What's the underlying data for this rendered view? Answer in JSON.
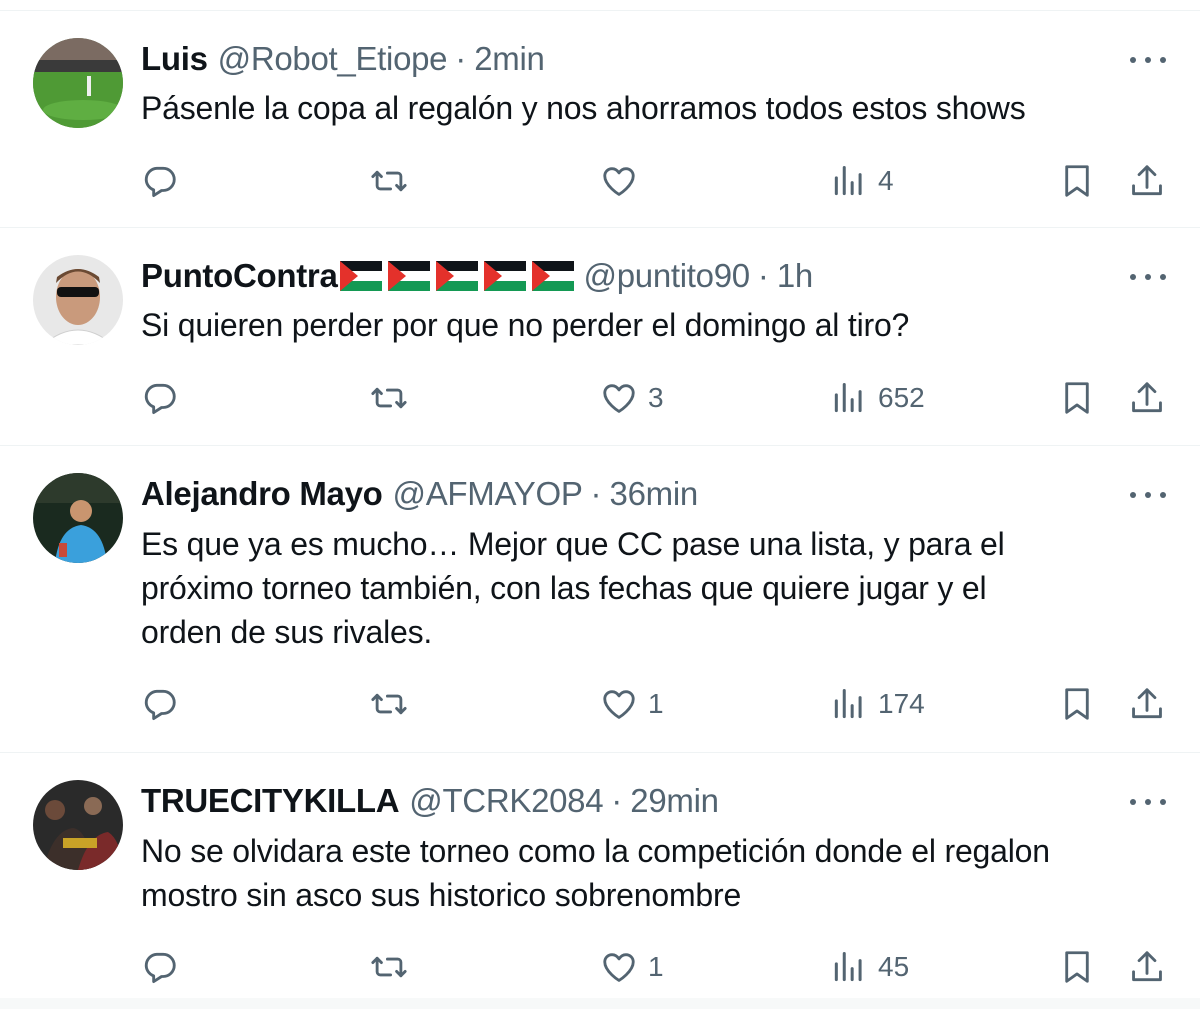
{
  "colors": {
    "text": "#0f1419",
    "muted": "#536471",
    "divider": "#eff3f4",
    "flag_red": "#e4312b",
    "flag_green": "#149954"
  },
  "icons": {
    "reply": "speech-bubble-icon",
    "retweet": "retweet-icon",
    "like": "heart-icon",
    "views": "bar-chart-icon",
    "bookmark": "bookmark-icon",
    "share": "share-icon",
    "more": "three-dots-icon",
    "flag": "palestine-flag-icon"
  },
  "tweets": [
    {
      "name": "Luis",
      "handle": "@Robot_Etiope",
      "separator": "·",
      "time": "2min",
      "text": "Pásenle la copa al regalón y nos ahorramos todos estos shows",
      "likes": "",
      "views": "4"
    },
    {
      "name": "PuntoContra",
      "handle": "@puntito90",
      "separator": "·",
      "time": "1h",
      "text": "Si quieren perder por que no perder el domingo al tiro?",
      "likes": "3",
      "views": "652",
      "flag_count": 5
    },
    {
      "name": "Alejandro Mayo",
      "handle": "@AFMAYOP",
      "separator": "·",
      "time": "36min",
      "text": "Es que ya es mucho… Mejor que CC pase una lista, y para el\npróximo torneo también, con las fechas que quiere jugar y el\norden de sus rivales.",
      "likes": "1",
      "views": "174"
    },
    {
      "name": "TRUECITYKILLA",
      "handle": "@TCRK2084",
      "separator": "·",
      "time": "29min",
      "text": "No se olvidara este torneo como la competición donde el regalon\nmostro sin asco sus historico sobrenombre",
      "likes": "1",
      "views": "45"
    }
  ]
}
